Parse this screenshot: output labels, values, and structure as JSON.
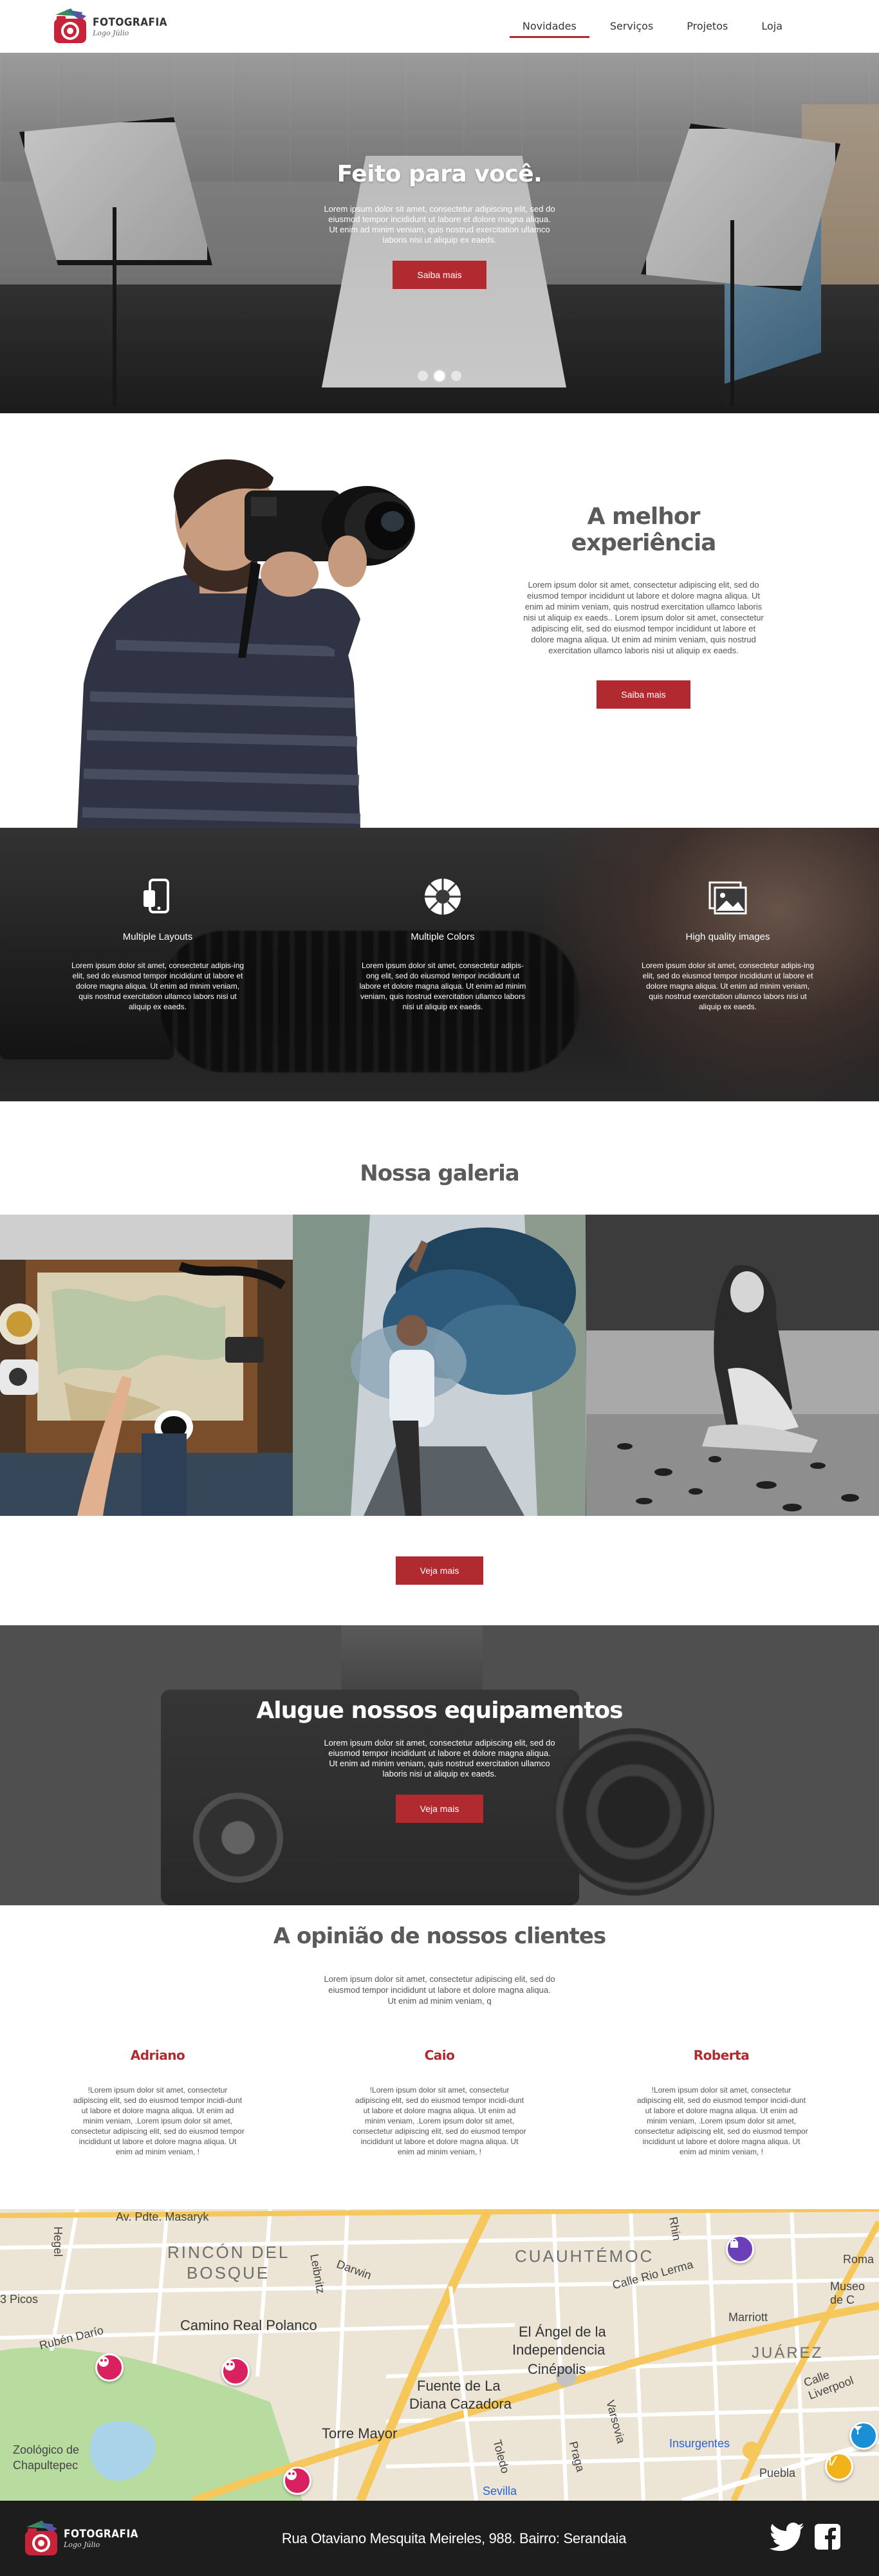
{
  "brand": {
    "name": "FOTOGRAFIA",
    "tagline": "Logo Júlio"
  },
  "nav": {
    "items": [
      {
        "label": "Novidades",
        "active": true
      },
      {
        "label": "Serviços",
        "active": false
      },
      {
        "label": "Projetos",
        "active": false
      },
      {
        "label": "Loja",
        "active": false
      }
    ]
  },
  "hero": {
    "title": "Feito para você.",
    "text": "Lorem ipsum dolor sit amet, consectetur adipiscing elit, sed do eiusmod tempor incididunt ut labore et dolore magna aliqua. Ut enim ad minim veniam, quis nostrud exercitation ullamco laboris nisi ut aliquip ex eaeds.",
    "button": "Saiba mais",
    "slides": 3,
    "active_slide": 2
  },
  "experience": {
    "title": "A melhor experiência",
    "text": "Lorem ipsum dolor sit amet, consectetur adipiscing elit, sed do eiusmod tempor incididunt ut labore et dolore magna aliqua. Ut enim ad minim veniam, quis nostrud exercitation ullamco laboris nisi ut aliquip ex eaeds.. Lorem ipsum dolor sit amet, consectetur adipiscing elit, sed do eiusmod tempor incididunt ut labore et dolore magna aliqua. Ut enim ad minim veniam, quis nostrud exercitation ullamco laboris nisi ut aliquip ex eaeds.",
    "button": "Saiba mais"
  },
  "features": [
    {
      "icon": "mobile-layout-icon",
      "title": "Multiple Layouts",
      "text": "Lorem ipsum dolor sit amet, consectetur adipis-ing elit, sed do eiusmod tempor incididunt ut labore et dolore magna aliqua. Ut enim ad minim veniam, quis nostrud exercitation ullamco labors nisi ut aliquip ex eaeds."
    },
    {
      "icon": "color-wheel-icon",
      "title": "Multiple Colors",
      "text": "Lorem ipsum dolor sit amet, consectetur adipis-ong elit, sed do eiusmod tempor incididunt ut labore et dolore magna aliqua. Ut enim ad minim veniam, quis nostrud exercitation ullamco labors nisi ut aliquip ex eaeds."
    },
    {
      "icon": "image-gallery-icon",
      "title": "High quality images",
      "text": "Lorem ipsum dolor sit amet, consectetur adipis-ing elit, sed do eiusmod tempor incididunt ut labore et dolore magna aliqua. Ut enim ad minim veniam, quis nostrud exercitation ullamco labors nisi ut aliquip ex eaeds."
    }
  ],
  "gallery": {
    "title": "Nossa galeria",
    "button": "Veja mais"
  },
  "rent": {
    "title": "Alugue nossos equipamentos",
    "text": "Lorem ipsum dolor sit amet, consectetur adipiscing elit, sed do eiusmod tempor incididunt ut labore et dolore magna aliqua. Ut enim ad minim veniam, quis nostrud exercitation ullamco laboris nisi ut aliquip ex eaeds.",
    "button": "Veja mais"
  },
  "testimonials": {
    "title": "A opinião de nossos clientes",
    "intro": "Lorem ipsum dolor sit amet, consectetur adipiscing elit, sed do eiusmod tempor incididunt ut labore et dolore magna aliqua. Ut enim ad minim veniam, q",
    "items": [
      {
        "name": "Adriano",
        "text": "!Lorem ipsum dolor sit amet, consectetur adipiscing elit, sed do eiusmod tempor incidi-dunt ut labore et dolore magna aliqua. Ut enim ad minim veniam, .Lorem ipsum dolor sit amet, consectetur adipiscing elit, sed do eiusmod tempor incididunt ut labore et dolore magna aliqua. Ut enim ad minim veniam, !"
      },
      {
        "name": "Caio",
        "text": "!Lorem ipsum dolor sit amet, consectetur adipiscing elit, sed do eiusmod tempor incidi-dunt ut labore et dolore magna aliqua. Ut enim ad minim veniam, .Lorem ipsum dolor sit amet, consectetur adipiscing elit, sed do eiusmod tempor incididunt ut labore et dolore magna aliqua. Ut enim ad minim veniam, !"
      },
      {
        "name": "Roberta",
        "text": "!Lorem ipsum dolor sit amet, consectetur adipiscing elit, sed do eiusmod tempor incidi-dunt ut labore et dolore magna aliqua. Ut enim ad minim veniam, .Lorem ipsum dolor sit amet, consectetur adipiscing elit, sed do eiusmod tempor incididunt ut labore et dolore magna aliqua. Ut enim ad minim veniam, !"
      }
    ]
  },
  "map": {
    "labels": {
      "masaryk": "Av. Pdte. Masaryk",
      "rincon": "RINCÓN DEL",
      "bosque": "BOSQUE",
      "cuauhtemoc": "CUAUHTÉMOC",
      "rio_lerma": "Calle Rio Lerma",
      "camino_real": "Camino Real Polanco",
      "angel": "El Ángel de la",
      "independencia": "Independencia",
      "cinepolis": "Cinépolis",
      "fuente": "Fuente de La",
      "diana": "Diana Cazadora",
      "torre_mayor": "Torre Mayor",
      "juarez": "JUÁREZ",
      "marriott": "Marriott",
      "zoologico": "Zoológico de",
      "chapultepec": "Chapultepec",
      "insurgentes": "Insurgentes",
      "picos": "3 Picos",
      "ruben_dario": "Rubén Darío",
      "museo": "Museo de C",
      "puebla": "Puebla",
      "sevilla": "Sevilla",
      "roma": "Roma",
      "hegel": "Hegel",
      "leibnitz": "Leibnitz",
      "darwin": "Darwin",
      "varsovia": "Varsovia",
      "praga": "Praga",
      "toledo": "Toledo",
      "liverpool": "Calle Liverpool",
      "rhin": "Rhin"
    }
  },
  "footer": {
    "address": "Rua Otaviano Mesquita Meireles, 988. Bairro: Serandaia"
  }
}
